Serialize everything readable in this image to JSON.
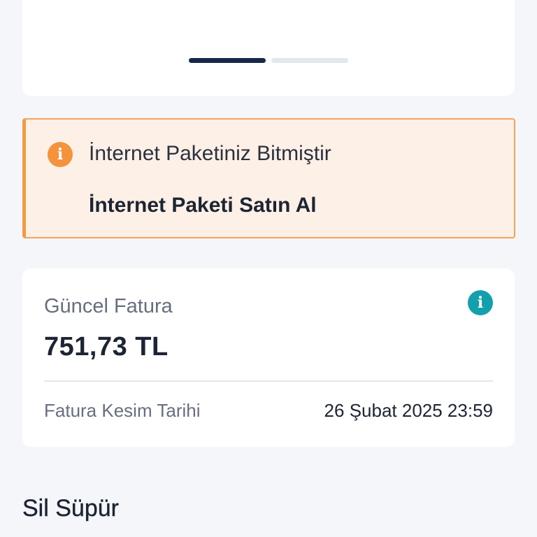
{
  "carousel": {
    "page_count": 2,
    "active_index": 0
  },
  "alert": {
    "icon": "info-icon",
    "icon_glyph": "i",
    "title": "İnternet Paketiniz Bitmiştir",
    "action_label": "İnternet Paketi Satın Al",
    "accent_color": "#f29a44",
    "background_color": "#fdf0e6"
  },
  "bill": {
    "label": "Güncel Fatura",
    "amount": "751,73 TL",
    "info_icon": "info-icon",
    "info_glyph": "i",
    "info_color": "#12a0ac",
    "due_label": "Fatura Kesim Tarihi",
    "due_value": "26 Şubat 2025 23:59"
  },
  "section": {
    "title": "Sil Süpür"
  },
  "colors": {
    "page_background": "#f4f6f9",
    "primary_dark": "#17294a"
  }
}
